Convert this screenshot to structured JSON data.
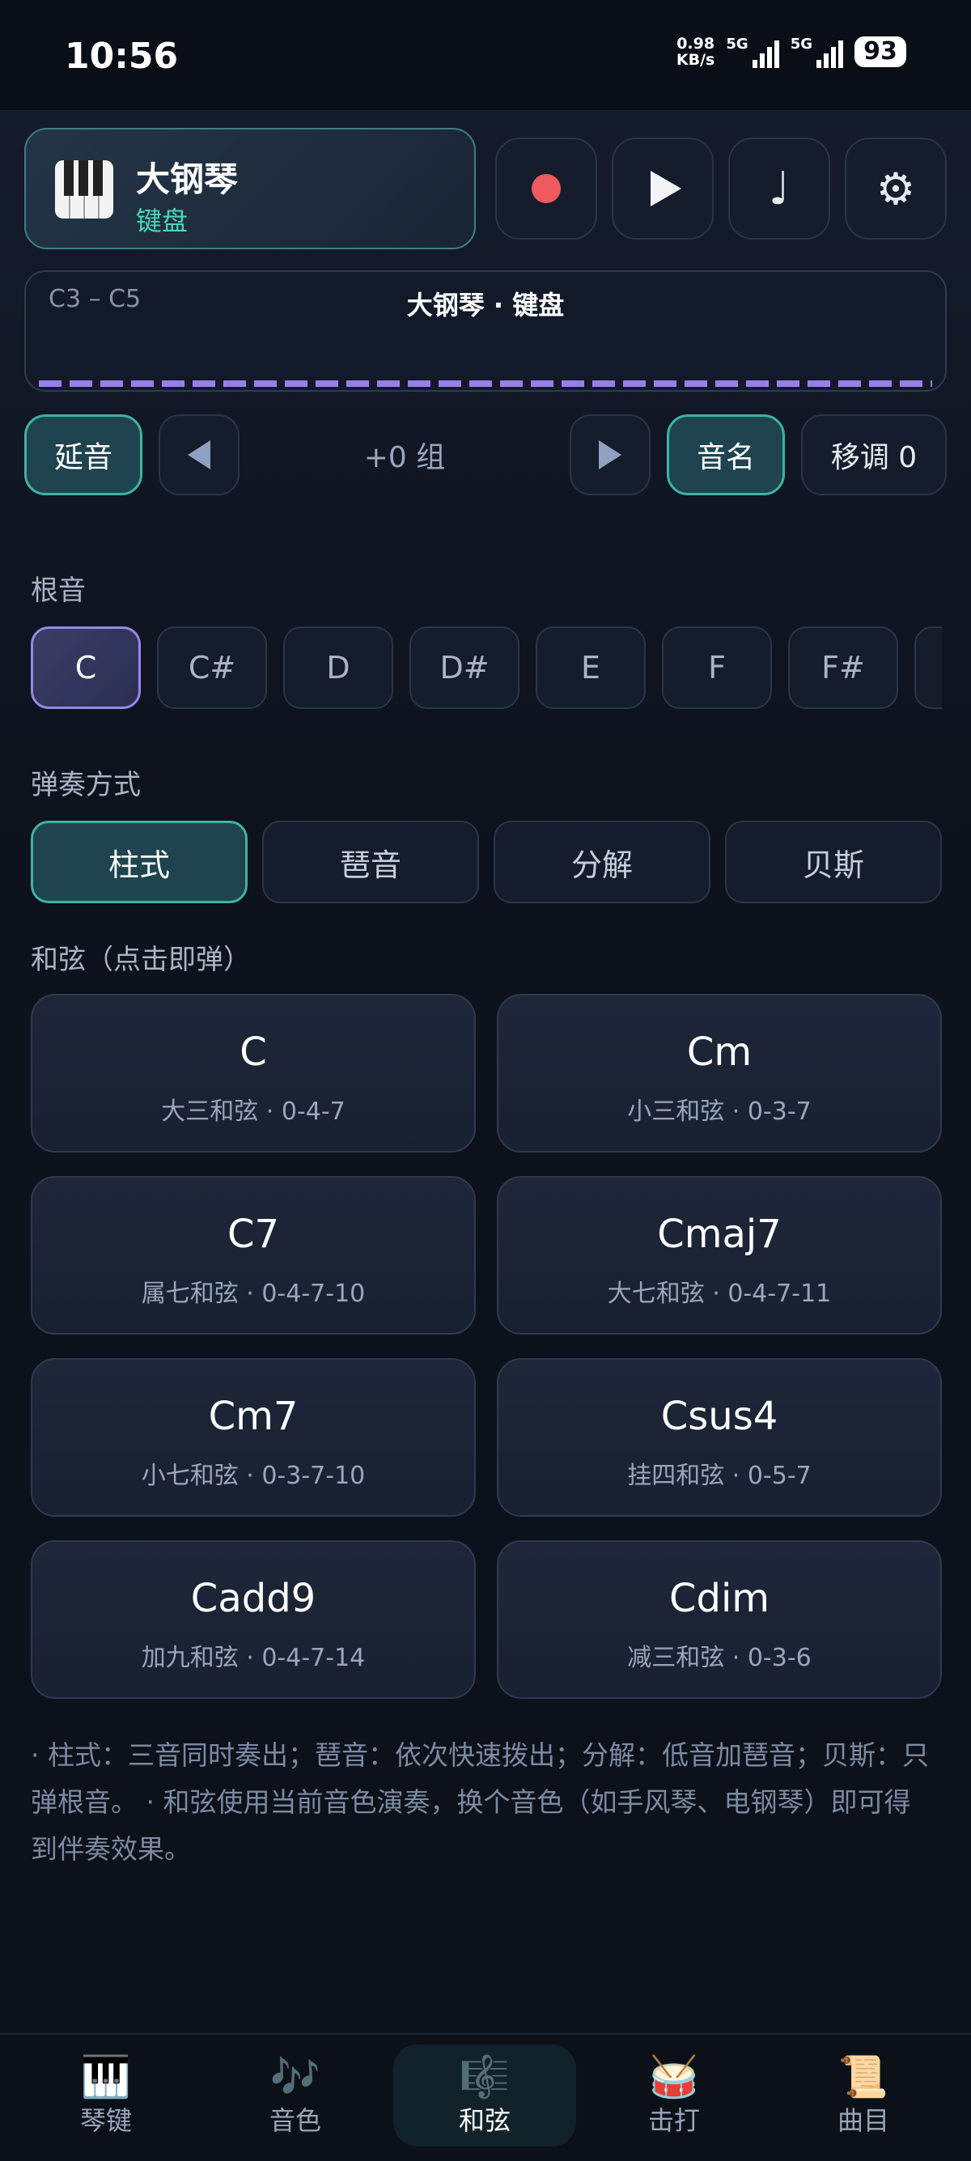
{
  "status": {
    "time": "10:56",
    "net_speed_value": "0.98",
    "net_speed_unit": "KB/s",
    "signal1": "5G",
    "signal2": "5G",
    "battery": "93"
  },
  "header": {
    "instrument_name": "大钢琴",
    "instrument_sub": "键盘",
    "record_icon": "record-icon",
    "play_icon": "play-icon",
    "note_icon": "music-note-icon",
    "settings_icon": "settings-icon"
  },
  "keyboard": {
    "range": "C3 – C5",
    "title": "大钢琴 · 键盘"
  },
  "controls": {
    "sustain": "延音",
    "octave": "+0 组",
    "note_names": "音名",
    "transpose": "移调 0"
  },
  "root_section": {
    "title": "根音",
    "roots": [
      "C",
      "C#",
      "D",
      "D#",
      "E",
      "F",
      "F#"
    ],
    "selected": "C"
  },
  "mode_section": {
    "title": "弹奏方式",
    "modes": [
      "柱式",
      "琶音",
      "分解",
      "贝斯"
    ],
    "selected": "柱式"
  },
  "chord_section": {
    "title": "和弦（点击即弹）",
    "chords": [
      {
        "name": "C",
        "desc": "大三和弦 · 0-4-7"
      },
      {
        "name": "Cm",
        "desc": "小三和弦 · 0-3-7"
      },
      {
        "name": "C7",
        "desc": "属七和弦 · 0-4-7-10"
      },
      {
        "name": "Cmaj7",
        "desc": "大七和弦 · 0-4-7-11"
      },
      {
        "name": "Cm7",
        "desc": "小七和弦 · 0-3-7-10"
      },
      {
        "name": "Csus4",
        "desc": "挂四和弦 · 0-5-7"
      },
      {
        "name": "Cadd9",
        "desc": "加九和弦 · 0-4-7-14"
      },
      {
        "name": "Cdim",
        "desc": "减三和弦 · 0-3-6"
      }
    ]
  },
  "footnote": "· 柱式：三音同时奏出；琶音：依次快速拨出；分解：低音加琶音；贝斯：只弹根音。 · 和弦使用当前音色演奏，换个音色（如手风琴、电钢琴）即可得到伴奏效果。",
  "nav": {
    "items": [
      {
        "label": "琴键",
        "icon": "🎹"
      },
      {
        "label": "音色",
        "icon": "🎶"
      },
      {
        "label": "和弦",
        "icon": "🎼"
      },
      {
        "label": "击打",
        "icon": "🥁"
      },
      {
        "label": "曲目",
        "icon": "📜"
      }
    ],
    "selected": "和弦"
  },
  "colors": {
    "accent_teal": "#3fb3a2",
    "accent_purple": "#9a86e6",
    "record_red": "#ef5a5e",
    "background": "#0c111b"
  }
}
